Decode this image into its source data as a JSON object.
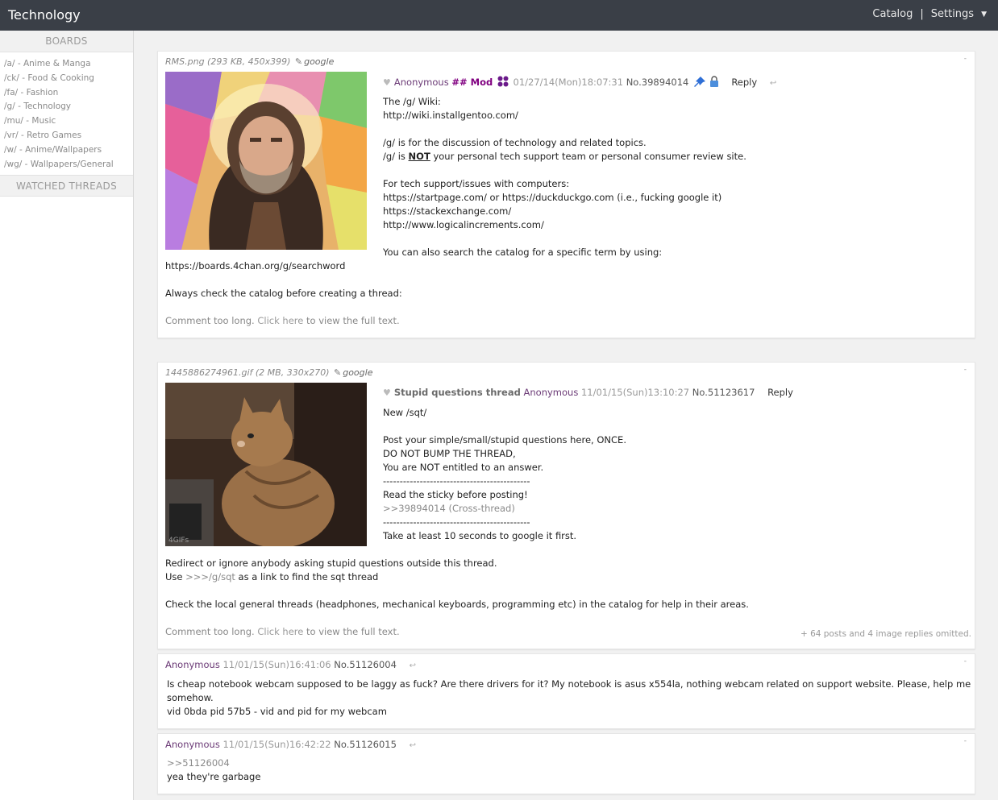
{
  "topbar": {
    "title": "Technology",
    "catalog": "Catalog",
    "separator": "|",
    "settings": "Settings",
    "caret": "▼"
  },
  "sidebar": {
    "boards_heading": "BOARDS",
    "boards": [
      "/a/ - Anime & Manga",
      "/ck/ - Food & Cooking",
      "/fa/ - Fashion",
      "/g/ - Technology",
      "/mu/ - Music",
      "/vr/ - Retro Games",
      "/w/ - Anime/Wallpapers",
      "/wg/ - Wallpapers/General"
    ],
    "watched_heading": "WATCHED THREADS"
  },
  "thread1": {
    "file_name": "RMS.png (293 KB, 450x399)",
    "file_search": "google",
    "name": "Anonymous",
    "capcode": "## Mod",
    "date": "01/27/14(Mon)18:07:31",
    "no_label": "No.",
    "number": "39894014",
    "reply": "Reply",
    "lines": {
      "l1": "The /g/ Wiki:",
      "l2": "http://wiki.installgentoo.com/",
      "l3": "/g/ is for the discussion of technology and related topics.",
      "l4a": "/g/ is ",
      "l4b": "NOT",
      "l4c": " your personal tech support team or personal consumer review site.",
      "l5": "For tech support/issues with computers:",
      "l6": "https://startpage.com/ or https://duckduckgo.com (i.e., fucking google it)",
      "l7": "https://stackexchange.com/",
      "l8": "http://www.logicalincrements.com/",
      "l9": "You can also search the catalog for a specific term by using:",
      "l10": "https://boards.4chan.org/g/searchword",
      "l11": "Always check the catalog before creating a thread:",
      "l12a": "Comment too long. ",
      "l12b": "Click here",
      "l12c": " to view the full text."
    }
  },
  "thread2": {
    "file_name": "1445886274961.gif (2 MB, 330x270)",
    "file_search": "google",
    "subject": "Stupid questions thread",
    "name": "Anonymous",
    "date": "11/01/15(Sun)13:10:27",
    "no_label": "No.",
    "number": "51123617",
    "reply": "Reply",
    "lines": {
      "l1": "New /sqt/",
      "l2": "Post your simple/small/stupid questions here, ONCE.",
      "l3": "DO NOT BUMP THE THREAD,",
      "l4": "You are NOT entitled to an answer.",
      "l5": "--------------------------------------------",
      "l6": "Read the sticky before posting!",
      "l7": ">>39894014 (Cross-thread)",
      "l8": "--------------------------------------------",
      "l9": "Take at least 10 seconds to google it first.",
      "l10": "Redirect or ignore anybody asking stupid questions outside this thread.",
      "l11a": "Use ",
      "l11b": ">>>/g/sqt",
      "l11c": " as a link to find the sqt thread",
      "l12": "Check the local general threads (headphones, mechanical keyboards, programming etc) in the catalog for help in their areas.",
      "l13a": "Comment too long. ",
      "l13b": "Click here",
      "l13c": " to view the full text."
    },
    "omitted": "+ 64 posts and 4 image replies omitted."
  },
  "reply1": {
    "name": "Anonymous",
    "date": "11/01/15(Sun)16:41:06",
    "no_label": "No.",
    "number": "51126004",
    "l1": "Is cheap notebook webcam supposed to be laggy as fuck? Are there drivers for it? My notebook is asus x554la, nothing webcam related on support website. Please, help me",
    "l2": "somehow.",
    "l3": "vid 0bda pid 57b5 - vid and pid for my webcam"
  },
  "reply2": {
    "name": "Anonymous",
    "date": "11/01/15(Sun)16:42:22",
    "no_label": "No.",
    "number": "51126015",
    "l1": ">>51126004",
    "l2": "yea they're garbage"
  },
  "icons": {
    "heart": "♥",
    "pen": "✎",
    "reply_arrow": "↩",
    "minus": "-"
  }
}
